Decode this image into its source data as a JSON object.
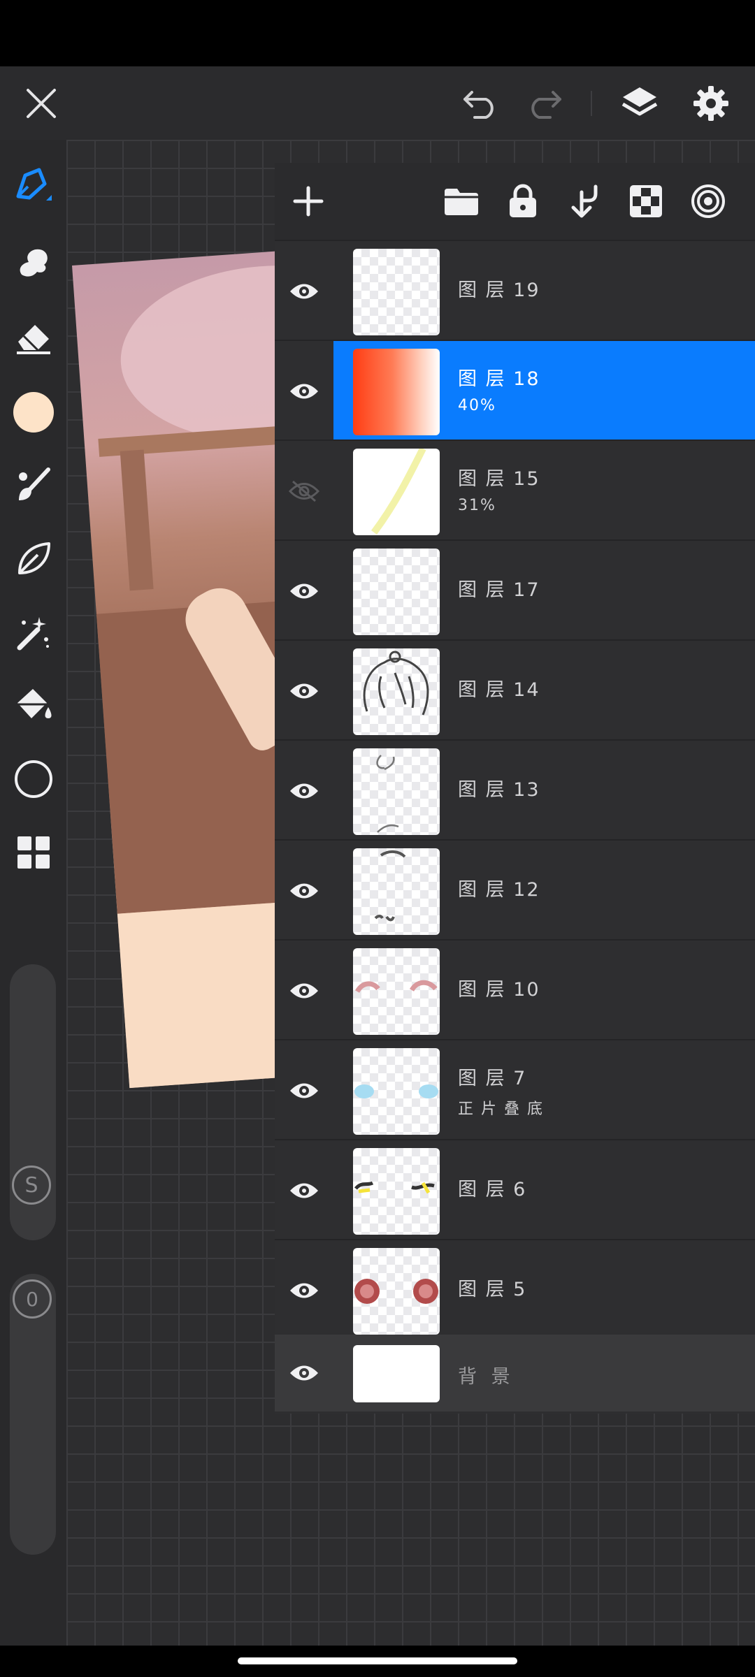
{
  "app": {
    "accent_color": "#0a7cfe",
    "background_color": "#2b2b2d"
  },
  "topbar": {
    "close_icon": "close-icon",
    "undo_icon": "undo-icon",
    "redo_icon": "redo-icon",
    "layers_icon": "layers-icon",
    "settings_icon": "gear-icon"
  },
  "left_toolbar": {
    "tools": [
      "pen",
      "smudge",
      "eraser",
      "color",
      "brush",
      "lasso",
      "magic-wand",
      "fill",
      "shape",
      "grid"
    ],
    "current_color": "#fde3c8",
    "stabilizer_label": "S",
    "opacity_label": "0"
  },
  "layers_panel": {
    "toolbar_icons": [
      "add-icon",
      "folder-icon",
      "lock-icon",
      "merge-down-icon",
      "transparency-icon",
      "target-icon"
    ],
    "layers": [
      {
        "name": "图 层 19",
        "subtitle": "",
        "visible": true,
        "selected": false,
        "thumb": "empty"
      },
      {
        "name": "图 层 18",
        "subtitle": "40%",
        "visible": true,
        "selected": true,
        "thumb": "red-gradient"
      },
      {
        "name": "图 层 15",
        "subtitle": "31%",
        "visible": false,
        "selected": false,
        "thumb": "yellow-stroke"
      },
      {
        "name": "图 层 17",
        "subtitle": "",
        "visible": true,
        "selected": false,
        "thumb": "empty"
      },
      {
        "name": "图 层 14",
        "subtitle": "",
        "visible": true,
        "selected": false,
        "thumb": "hair-sketch"
      },
      {
        "name": "图 层 13",
        "subtitle": "",
        "visible": true,
        "selected": false,
        "thumb": "face-sketch"
      },
      {
        "name": "图 层 12",
        "subtitle": "",
        "visible": true,
        "selected": false,
        "thumb": "brows"
      },
      {
        "name": "图 层 10",
        "subtitle": "",
        "visible": true,
        "selected": false,
        "thumb": "eyelids"
      },
      {
        "name": "图 层 7",
        "subtitle": "正 片 叠 底",
        "visible": true,
        "selected": false,
        "thumb": "blush"
      },
      {
        "name": "图 层 6",
        "subtitle": "",
        "visible": true,
        "selected": false,
        "thumb": "eye-highlights"
      },
      {
        "name": "图 层 5",
        "subtitle": "",
        "visible": true,
        "selected": false,
        "thumb": "eyes"
      }
    ],
    "background_layer": {
      "name": "背 景",
      "visible": true
    }
  }
}
